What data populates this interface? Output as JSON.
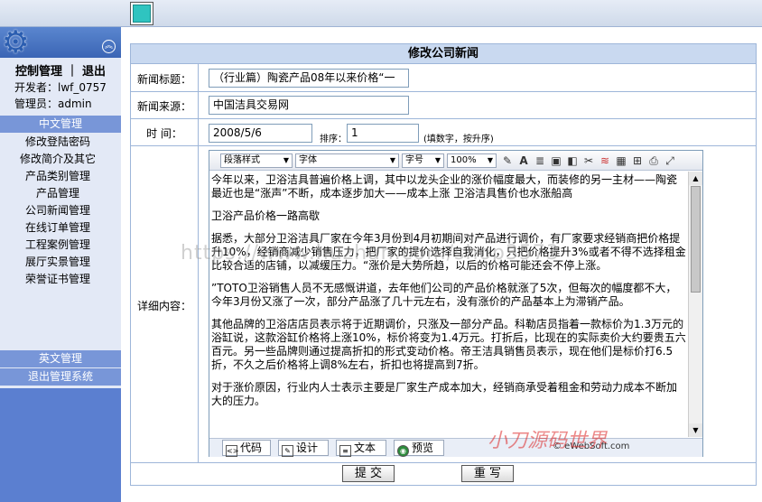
{
  "sidebar": {
    "ctrl_label": "控制管理 ｜ 退出",
    "developer": "开发者：lwf_0757",
    "admin": "管理员：admin",
    "section_cn": "中文管理",
    "items": [
      "修改登陆密码",
      "修改简介及其它",
      "产品类别管理",
      "产品管理",
      "公司新闻管理",
      "在线订单管理",
      "工程案例管理",
      "展厅实景管理",
      "荣誉证书管理"
    ],
    "section_en": "英文管理",
    "logout": "退出管理系统"
  },
  "form": {
    "title": "修改公司新闻",
    "news_title_label": "新闻标题：",
    "news_title_value": "（行业篇）陶瓷产品08年以来价格“一",
    "source_label": "新闻来源：",
    "source_value": "中国洁具交易网",
    "time_label": "时  间：",
    "time_value": "2008/5/6",
    "sort_label": "排序：",
    "sort_value": "1",
    "sort_hint": "(填数字，按升序)",
    "detail_label": "详细内容：",
    "submit": "提  交",
    "reset": "重  写"
  },
  "editor": {
    "paragraph_select": "段落样式",
    "font_select": "字体",
    "size_select": "字号",
    "zoom_select": "100%",
    "paragraphs": [
      "今年以来，卫浴洁具普遍价格上调，其中以龙头企业的涨价幅度最大，而装修的另一主材——陶瓷最近也是“涨声”不断，成本逐步加大——成本上涨 卫浴洁具售价也水涨船高",
      "    卫浴产品价格一路高歇",
      "    据悉，大部分卫浴洁具厂家在今年3月份到4月初期间对产品进行调价，有厂家要求经销商把价格提升10%，经销商减少销售压力，把厂家的提价选择自我消化，只把价格提升3%或者不得不选择租金比较合适的店铺，以减缓压力。“涨价是大势所趋，以后的价格可能还会不停上涨。",
      "”TOTO卫浴销售人员不无感慨讲道，去年他们公司的产品价格就涨了5次，但每次的幅度都不大，今年3月份又涨了一次，部分产品涨了几十元左右，没有涨价的产品基本上为滞销产品。",
      "    其他品牌的卫浴店店员表示将于近期调价，只涨及一部分产品。科勒店员指着一款标价为1.3万元的浴缸说，这款浴缸价格将上涨10%，标价将变为1.4万元。打折后，比现在的实际卖价大约要贵五六百元。另一些品牌则通过提高折扣的形式变动价格。帝王洁具销售员表示，现在他们是标价打6.5折，不久之后价格将上调8%左右，折扣也将提高到7折。",
      "    对于涨价原因，行业内人士表示主要是厂家生产成本加大，经销商承受着租金和劳动力成本不断加大的压力。"
    ],
    "mode_code": "代码",
    "mode_design": "设计",
    "mode_text": "文本",
    "mode_preview": "预览",
    "logo_text": "© eWebSoft.com"
  },
  "watermark": {
    "url": "https://www.huzhan.com/shop3573",
    "site": "小刀源码世界"
  }
}
